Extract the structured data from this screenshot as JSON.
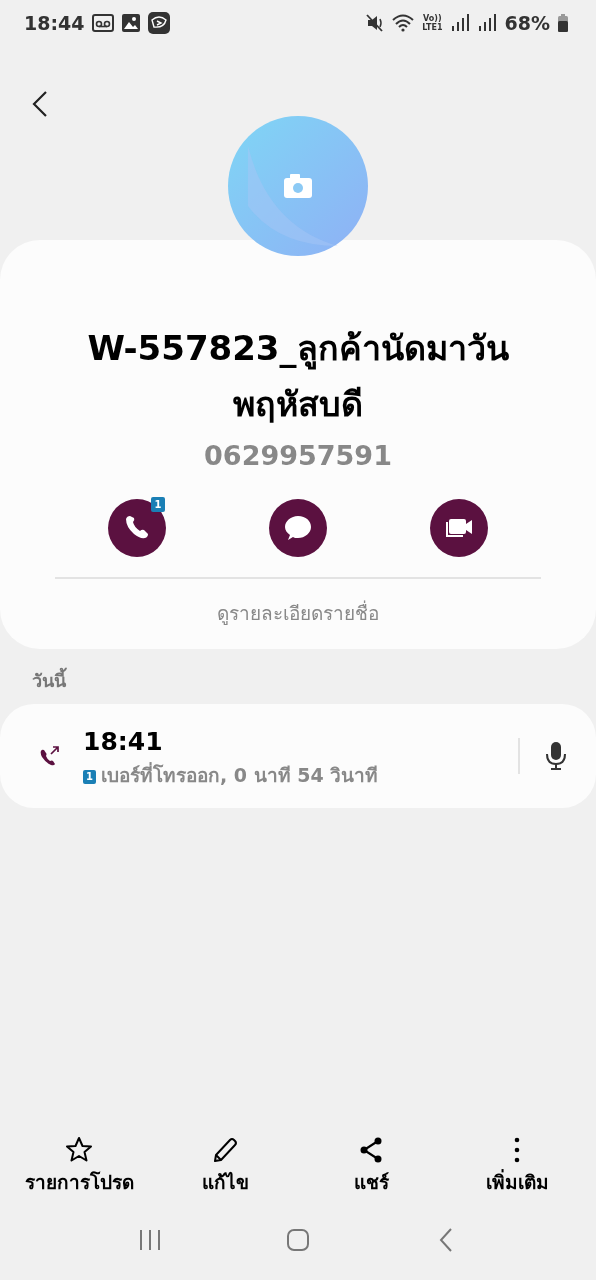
{
  "status_bar": {
    "time": "18:44",
    "volte": "Vo))",
    "lte": "LTE1",
    "battery": "68%"
  },
  "contact": {
    "name_lines": [
      "W-557823_ลูกค้านัดมาวัน",
      "พฤหัสบดี"
    ],
    "phone": "0629957591",
    "details_link": "ดูรายละเอียดรายชื่อ"
  },
  "actions": [
    {
      "kind": "call",
      "badge": "1"
    },
    {
      "kind": "message"
    },
    {
      "kind": "video"
    }
  ],
  "history": {
    "heading": "วันนี้",
    "calls": [
      {
        "kind": "outgoing",
        "time": "18:41",
        "sim": "1",
        "detail": "เบอร์ที่โทรออก, 0 นาที 54 วินาที"
      }
    ]
  },
  "bottom_bar": [
    {
      "kind": "favorite",
      "label": "รายการโปรด"
    },
    {
      "kind": "edit",
      "label": "แก้ไข"
    },
    {
      "kind": "share",
      "label": "แชร์"
    },
    {
      "kind": "more",
      "label": "เพิ่มเติม"
    }
  ]
}
